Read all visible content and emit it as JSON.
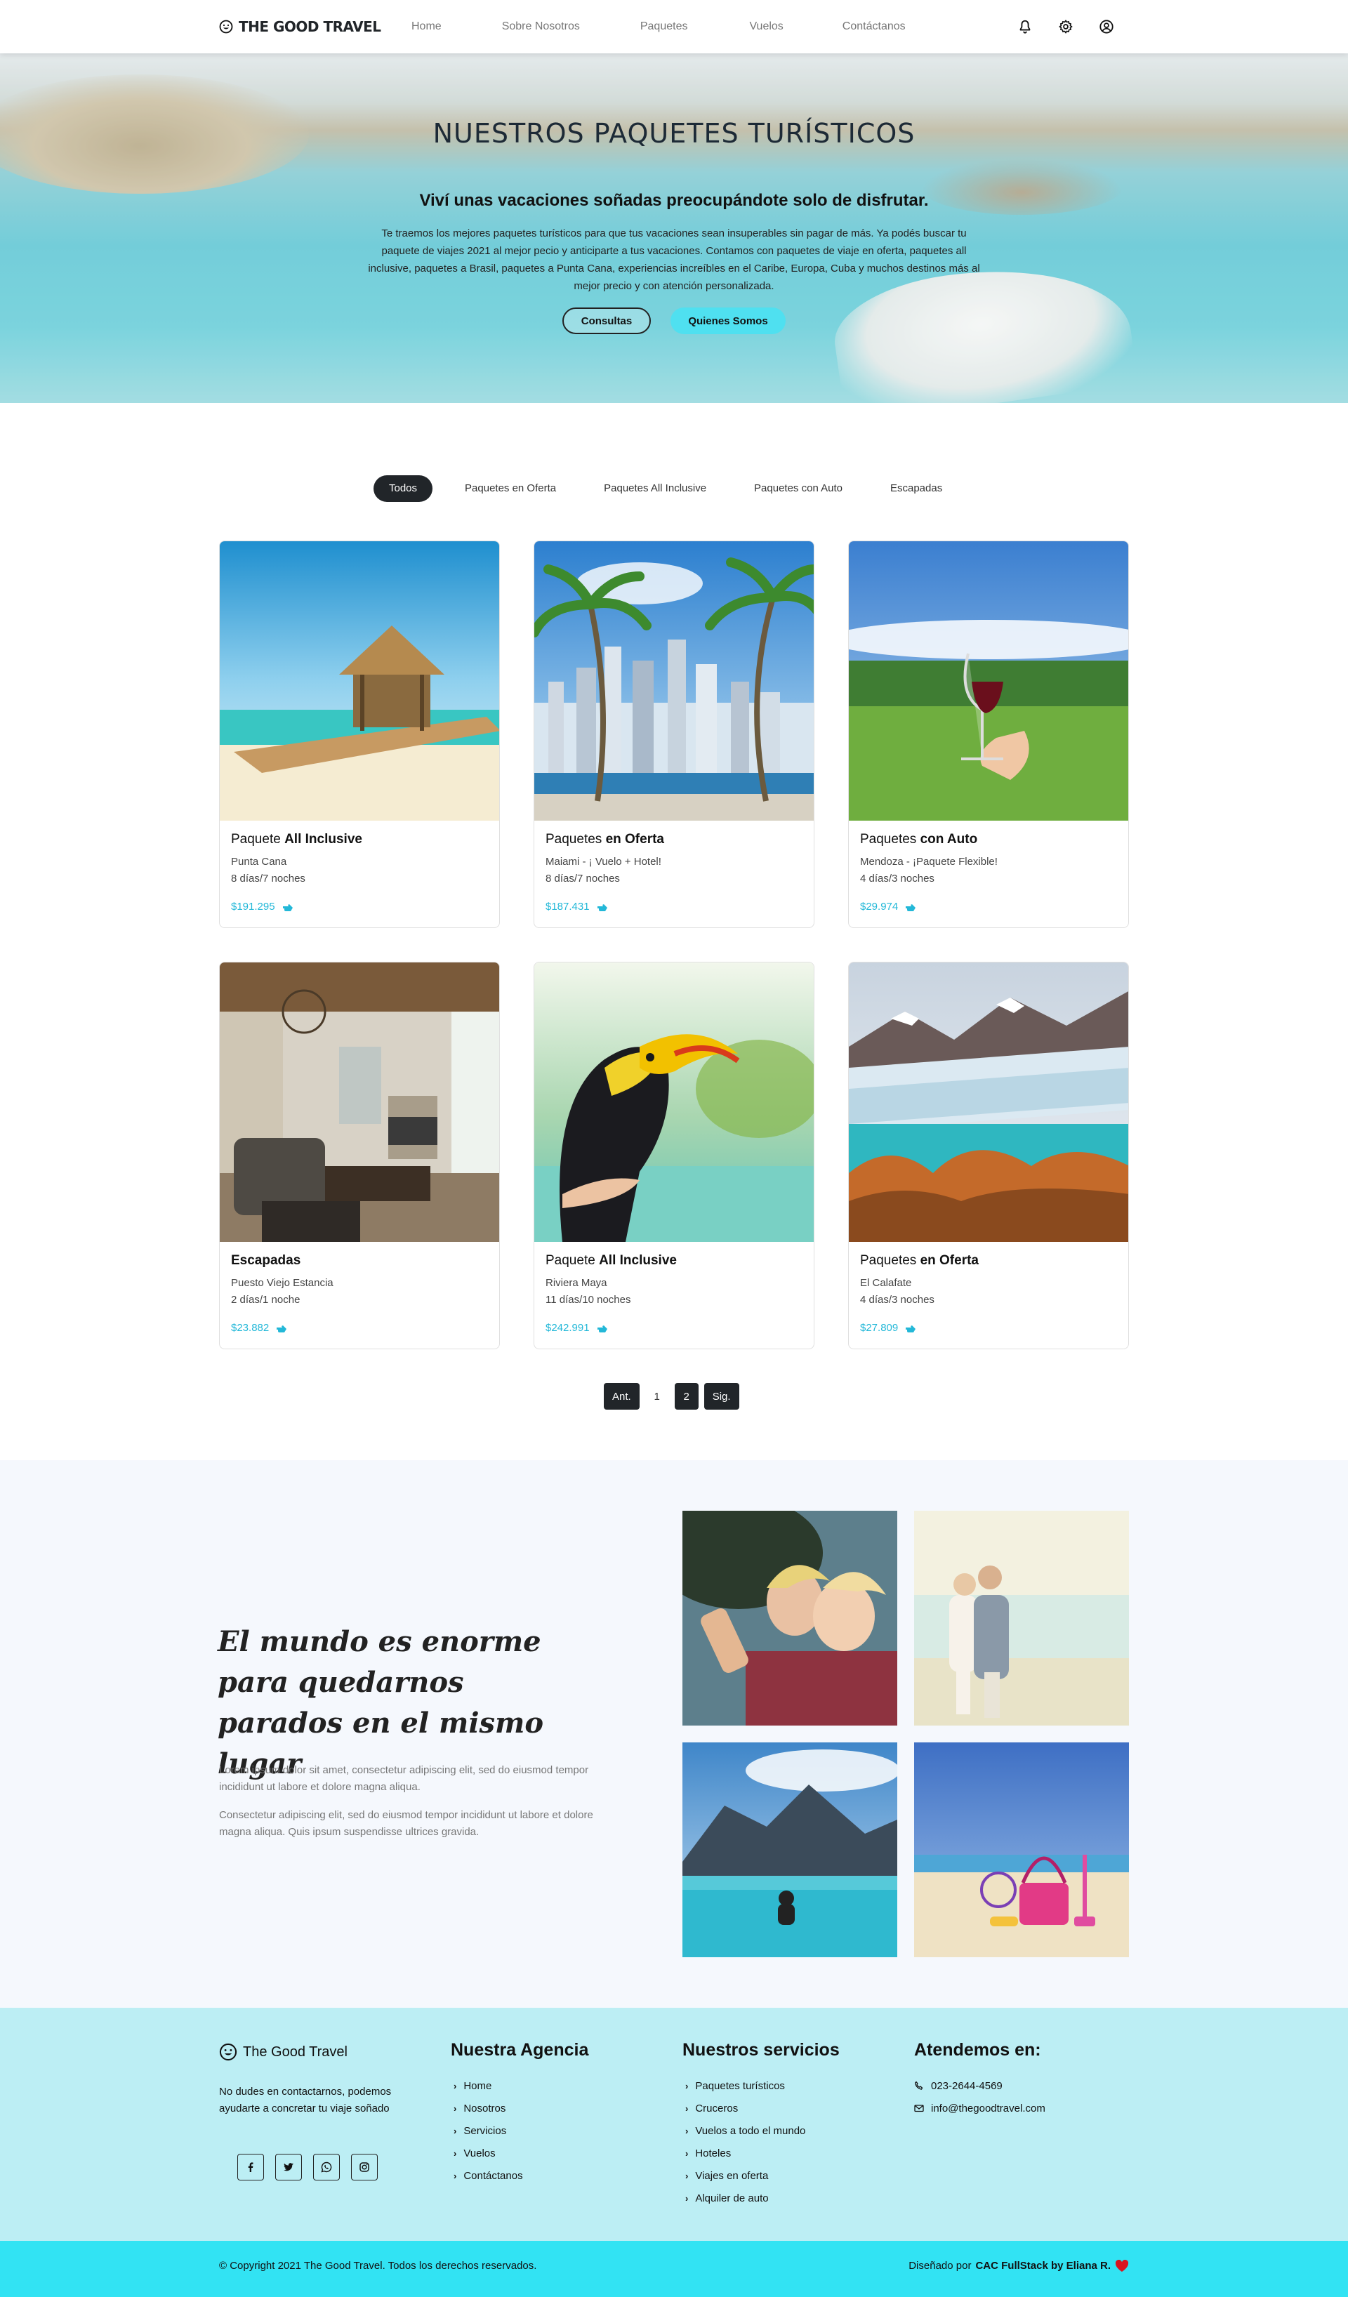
{
  "brand": {
    "name": "The Good Travel",
    "logo_text": "THE GOOD TRAVEL"
  },
  "nav": {
    "items": [
      "Home",
      "Sobre Nosotros",
      "Paquetes",
      "Vuelos",
      "Contáctanos"
    ]
  },
  "header_icons": [
    "bell-icon",
    "gear-icon",
    "user-circle-icon"
  ],
  "hero": {
    "title": "NUESTROS PAQUETES TURÍSTICOS",
    "subtitle": "Viví unas vacaciones soñadas preocupándote solo de disfrutar.",
    "text": "Te traemos los mejores paquetes turísticos para que tus vacaciones sean insuperables sin pagar de más. Ya podés buscar tu paquete de viajes 2021 al mejor pecio y anticiparte a tus vacaciones. Contamos con paquetes de viaje en oferta, paquetes all inclusive, paquetes a Brasil, paquetes a Punta Cana, experiencias increíbles en el Caribe, Europa, Cuba y muchos destinos más al mejor precio y con atención personalizada.",
    "btn_consultas": "Consultas",
    "btn_quienes": "Quienes Somos"
  },
  "filters": {
    "items": [
      "Todos",
      "Paquetes en Oferta",
      "Paquetes All Inclusive",
      "Paquetes con Auto",
      "Escapadas"
    ],
    "active": "Todos"
  },
  "cards": [
    {
      "title_a": "Paquete ",
      "title_b": "All Inclusive",
      "location": "Punta Cana",
      "duration": "8 días/7 noches",
      "price": "$191.295"
    },
    {
      "title_a": "Paquetes ",
      "title_b": "en Oferta",
      "location": "Maiami - ¡ Vuelo + Hotel!",
      "duration": "8 días/7 noches",
      "price": "$187.431"
    },
    {
      "title_a": "Paquetes ",
      "title_b": "con Auto",
      "location": "Mendoza - ¡Paquete Flexible!",
      "duration": "4 días/3 noches",
      "price": "$29.974"
    },
    {
      "title_a": "",
      "title_b": "Escapadas",
      "location": "Puesto Viejo Estancia",
      "duration": "2 días/1 noche",
      "price": "$23.882"
    },
    {
      "title_a": "Paquete ",
      "title_b": "All Inclusive",
      "location": "Riviera Maya",
      "duration": "11 días/10 noches",
      "price": "$242.991"
    },
    {
      "title_a": "Paquetes ",
      "title_b": "en Oferta",
      "location": "El Calafate",
      "duration": "4 días/3 noches",
      "price": "$27.809"
    }
  ],
  "pagination": {
    "prev": "Ant.",
    "pages": [
      "1",
      "2"
    ],
    "current": "2",
    "next": "Sig."
  },
  "about": {
    "title": "El mundo es enorme para quedarnos parados en el mismo lugar",
    "p1": "Lorem ipsum dolor sit amet, consectetur adipiscing elit, sed do eiusmod tempor incididunt ut labore et dolore magna aliqua.",
    "p2": "Consectetur adipiscing elit, sed do eiusmod tempor incididunt ut labore et dolore magna aliqua. Quis ipsum suspendisse ultrices gravida."
  },
  "footer": {
    "brand": "The Good Travel",
    "desc": "No dudes en contactarnos, podemos ayudarte a concretar tu viaje soñado",
    "social": [
      "facebook-icon",
      "twitter-icon",
      "whatsapp-icon",
      "instagram-icon"
    ],
    "agency_title": "Nuestra Agencia",
    "agency_links": [
      "Home",
      "Nosotros",
      "Servicios",
      "Vuelos",
      "Contáctanos"
    ],
    "services_title": "Nuestros servicios",
    "services_links": [
      "Paquetes turísticos",
      "Cruceros",
      "Vuelos a todo el mundo",
      "Hoteles",
      "Viajes en oferta",
      "Alquiler de auto"
    ],
    "contact_title": "Atendemos en:",
    "phone": "023-2644-4569",
    "email": "info@thegoodtravel.com",
    "copyright": "© Copyright 2021 The Good Travel. Todos los derechos reservados.",
    "designed_by": "Diseñado por",
    "designer": "CAC FullStack by Eliana R.",
    "accent": "#32e3f3"
  }
}
